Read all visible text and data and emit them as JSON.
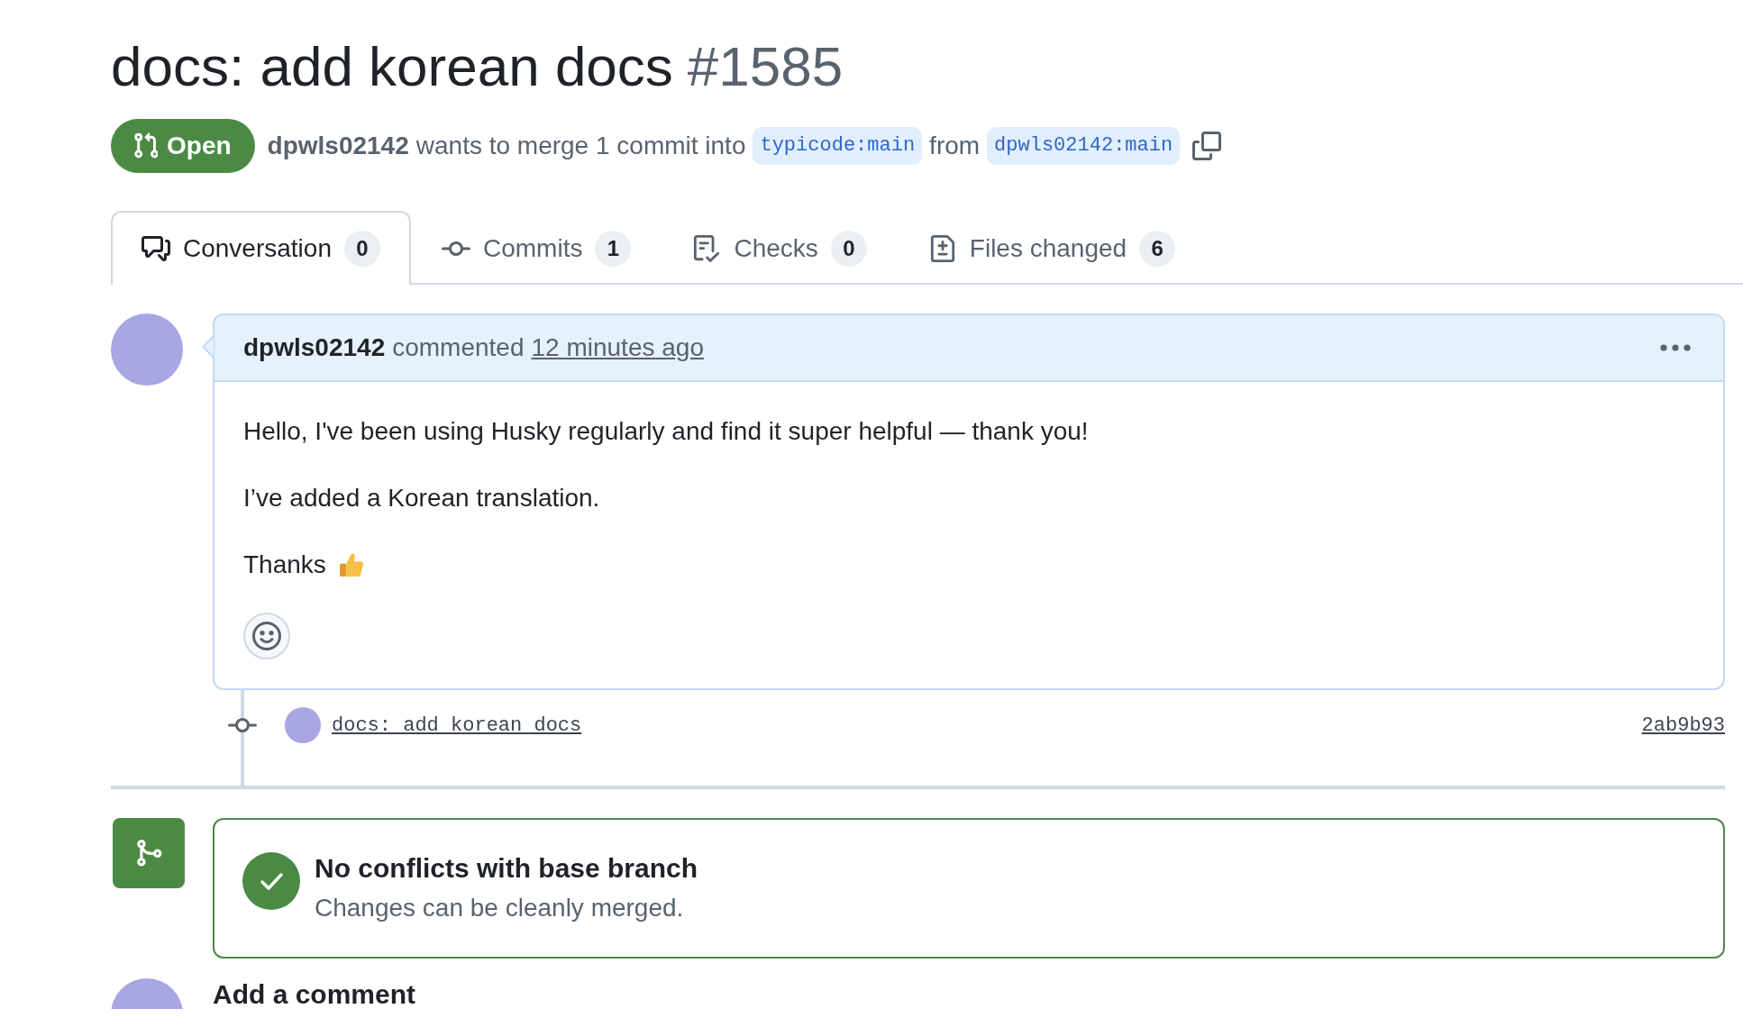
{
  "pull_request": {
    "title": "docs: add korean docs",
    "number": "#1585",
    "state": {
      "label": "Open",
      "kind": "open"
    },
    "author": "dpwls02142",
    "summary": "wants to merge 1 commit into",
    "base_branch": "typicode:main",
    "joiner": "from",
    "head_branch": "dpwls02142:main"
  },
  "tabs": [
    {
      "label": "Conversation",
      "count": "0",
      "kind": "conversation",
      "selected": true
    },
    {
      "label": "Commits",
      "count": "1",
      "kind": "commits",
      "selected": false
    },
    {
      "label": "Checks",
      "count": "0",
      "kind": "checks",
      "selected": false
    },
    {
      "label": "Files changed",
      "count": "6",
      "kind": "files_changed",
      "selected": false
    }
  ],
  "comment": {
    "author": "dpwls02142",
    "action": "commented",
    "time": "12 minutes ago",
    "paragraphs": [
      {
        "text": "Hello, I've been using Husky regularly and find it super helpful — thank you!",
        "kind": "text"
      },
      {
        "text": "I’ve added a Korean translation.",
        "kind": "text"
      },
      {
        "text": "Thanks",
        "kind": "text_with_emoji"
      }
    ]
  },
  "commit": {
    "message": "docs: add korean docs",
    "sha": "2ab9b93"
  },
  "merge_status": {
    "kind": "clean",
    "heading": "No conflicts with base branch",
    "detail": "Changes can be cleanly merged."
  },
  "new_comment": {
    "heading": "Add a comment"
  }
}
